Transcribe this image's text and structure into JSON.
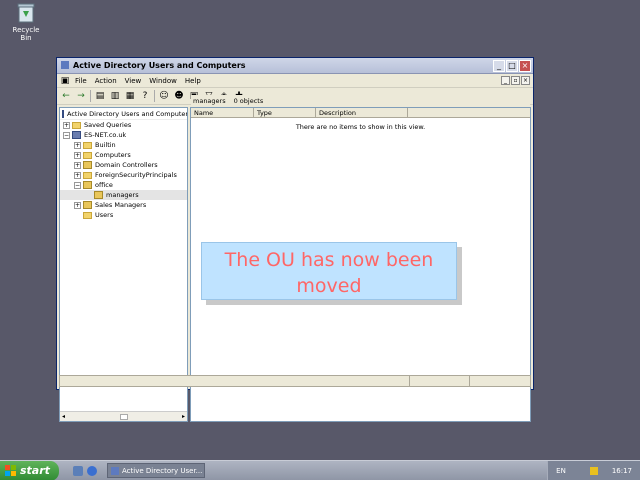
{
  "desktop": {
    "recycle_bin_label": "Recycle Bin"
  },
  "window": {
    "title": "Active Directory Users and Computers",
    "menu": [
      "File",
      "Action",
      "View",
      "Window",
      "Help"
    ]
  },
  "tree": {
    "root_label": "Active Directory Users and Computers",
    "items": [
      {
        "label": "Saved Queries"
      },
      {
        "label": "ES-NET.co.uk"
      },
      {
        "label": "Builtin"
      },
      {
        "label": "Computers"
      },
      {
        "label": "Domain Controllers"
      },
      {
        "label": "ForeignSecurityPrincipals"
      },
      {
        "label": "office"
      },
      {
        "label": "managers"
      },
      {
        "label": "Sales Managers"
      },
      {
        "label": "Users"
      }
    ]
  },
  "detail": {
    "header_name": "managers",
    "header_count": "0 objects",
    "columns": [
      "Name",
      "Type",
      "Description"
    ],
    "empty_message": "There are no items to show in this view."
  },
  "overlay": {
    "line1": "The OU has now been",
    "line2": "moved"
  },
  "taskbar": {
    "start_label": "start",
    "task_label": "Active Directory User...",
    "lang": "EN",
    "clock": "16:17"
  }
}
